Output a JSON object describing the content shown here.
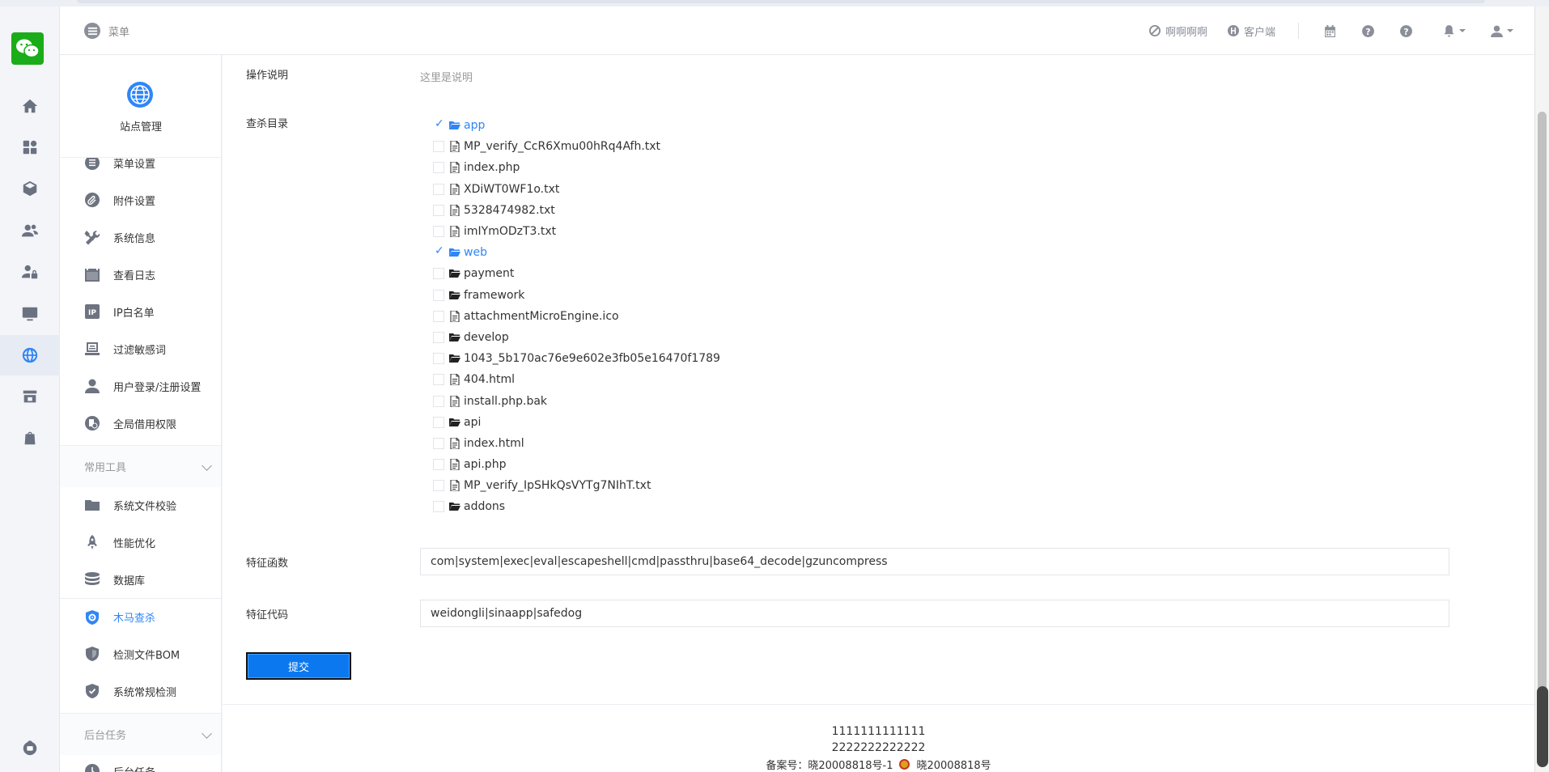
{
  "header": {
    "menu_label": "菜单",
    "links": [
      "啊啊啊啊",
      "客户端"
    ]
  },
  "sidebar": {
    "site_title": "站点管理",
    "items": [
      {
        "label": "菜单设置",
        "icon": "list-icon"
      },
      {
        "label": "附件设置",
        "icon": "paperclip-icon"
      },
      {
        "label": "系统信息",
        "icon": "tools-icon"
      },
      {
        "label": "查看日志",
        "icon": "calendar-icon"
      },
      {
        "label": "IP白名单",
        "icon": "ip-icon"
      },
      {
        "label": "过滤敏感词",
        "icon": "filter-icon"
      },
      {
        "label": "用户登录/注册设置",
        "icon": "user-icon"
      },
      {
        "label": "全局借用权限",
        "icon": "permission-icon"
      }
    ],
    "group_tools": "常用工具",
    "tools": [
      {
        "label": "系统文件校验",
        "icon": "folder-icon"
      },
      {
        "label": "性能优化",
        "icon": "rocket-icon"
      },
      {
        "label": "数据库",
        "icon": "database-icon"
      },
      {
        "label": "木马查杀",
        "icon": "shield-scan-icon",
        "active": true
      },
      {
        "label": "检测文件BOM",
        "icon": "shield-icon"
      },
      {
        "label": "系统常规检测",
        "icon": "shield-check-icon"
      }
    ],
    "group_tasks": "后台任务",
    "tasks": [
      {
        "label": "后台任务",
        "icon": "task-icon"
      }
    ]
  },
  "form": {
    "desc_label": "操作说明",
    "desc_text": "这里是说明",
    "dir_label": "查杀目录",
    "tree": [
      {
        "name": "app",
        "type": "dir",
        "checked": true
      },
      {
        "name": "MP_verify_CcR6Xmu00hRq4Afh.txt",
        "type": "file",
        "checked": false
      },
      {
        "name": "index.php",
        "type": "file",
        "checked": false
      },
      {
        "name": "XDiWT0WF1o.txt",
        "type": "file",
        "checked": false
      },
      {
        "name": "5328474982.txt",
        "type": "file",
        "checked": false
      },
      {
        "name": "imIYmODzT3.txt",
        "type": "file",
        "checked": false
      },
      {
        "name": "web",
        "type": "dir",
        "checked": true
      },
      {
        "name": "payment",
        "type": "dir",
        "checked": false
      },
      {
        "name": "framework",
        "type": "dir",
        "checked": false
      },
      {
        "name": "attachmentMicroEngine.ico",
        "type": "file",
        "checked": false
      },
      {
        "name": "develop",
        "type": "dir",
        "checked": false
      },
      {
        "name": "1043_5b170ac76e9e602e3fb05e16470f1789",
        "type": "dir",
        "checked": false
      },
      {
        "name": "404.html",
        "type": "file",
        "checked": false
      },
      {
        "name": "install.php.bak",
        "type": "file",
        "checked": false
      },
      {
        "name": "api",
        "type": "dir",
        "checked": false
      },
      {
        "name": "index.html",
        "type": "file",
        "checked": false
      },
      {
        "name": "api.php",
        "type": "file",
        "checked": false
      },
      {
        "name": "MP_verify_IpSHkQsVYTg7NIhT.txt",
        "type": "file",
        "checked": false
      },
      {
        "name": "addons",
        "type": "dir",
        "checked": false
      }
    ],
    "func_label": "特征函数",
    "func_value": "com|system|exec|eval|escapeshell|cmd|passthru|base64_decode|gzuncompress",
    "code_label": "特征代码",
    "code_value": "weidongli|sinaapp|safedog",
    "submit_label": "提交"
  },
  "footer": {
    "line1": "1111111111111",
    "line2": "2222222222222",
    "icp": "备案号：晓20008818号-1",
    "police": "晓20008818号"
  },
  "colors": {
    "accent": "#2f86f6",
    "brand_green": "#1aad19",
    "submit_bg": "#0b78f0"
  }
}
